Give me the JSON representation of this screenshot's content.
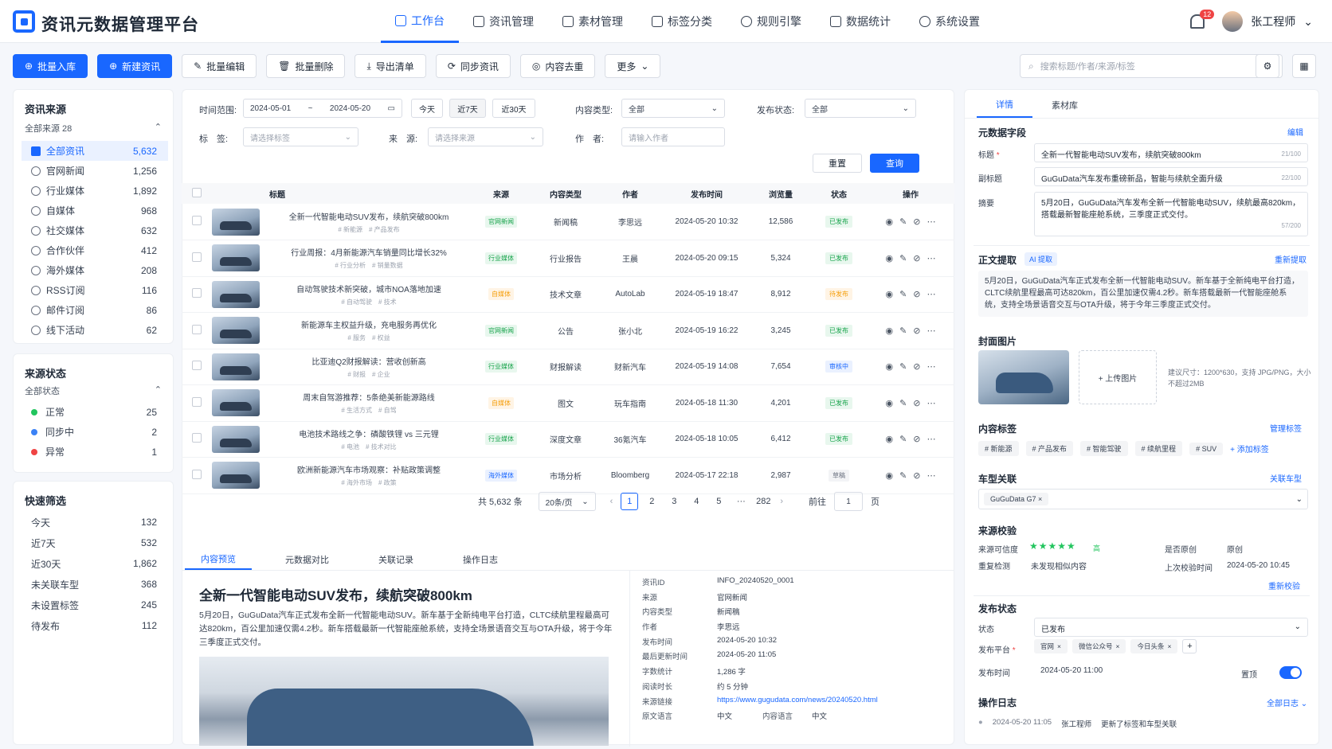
{
  "app": {
    "title": "资讯元数据管理平台"
  },
  "nav": [
    {
      "label": "工作台"
    },
    {
      "label": "资讯管理"
    },
    {
      "label": "素材管理"
    },
    {
      "label": "标签分类"
    },
    {
      "label": "规则引擎"
    },
    {
      "label": "数据统计"
    },
    {
      "label": "系统设置"
    }
  ],
  "user": {
    "name": "张工程师",
    "notifications": "12"
  },
  "toolbar": {
    "import": "批量入库",
    "new": "新建资讯",
    "edit": "批量编辑",
    "delete": "批量删除",
    "export": "导出清单",
    "sync": "同步资讯",
    "dedupe": "内容去重",
    "more": "更多",
    "search_placeholder": "搜索标题/作者/来源/标签"
  },
  "sources": {
    "title": "资讯来源",
    "all": "全部来源 28",
    "items": [
      {
        "label": "全部资讯",
        "count": "5,632"
      },
      {
        "label": "官网新闻",
        "count": "1,256"
      },
      {
        "label": "行业媒体",
        "count": "1,892"
      },
      {
        "label": "自媒体",
        "count": "968"
      },
      {
        "label": "社交媒体",
        "count": "632"
      },
      {
        "label": "合作伙伴",
        "count": "412"
      },
      {
        "label": "海外媒体",
        "count": "208"
      },
      {
        "label": "RSS订阅",
        "count": "116"
      },
      {
        "label": "邮件订阅",
        "count": "86"
      },
      {
        "label": "线下活动",
        "count": "62"
      }
    ]
  },
  "source_status": {
    "title": "来源状态",
    "all": "全部状态",
    "items": [
      {
        "label": "正常",
        "count": "25",
        "color": "#22c55e"
      },
      {
        "label": "同步中",
        "count": "2",
        "color": "#3b82f6"
      },
      {
        "label": "异常",
        "count": "1",
        "color": "#ef4444"
      }
    ]
  },
  "quick": {
    "title": "快速筛选",
    "items": [
      {
        "label": "今天",
        "count": "132"
      },
      {
        "label": "近7天",
        "count": "532"
      },
      {
        "label": "近30天",
        "count": "1,862"
      },
      {
        "label": "未关联车型",
        "count": "368"
      },
      {
        "label": "未设置标签",
        "count": "245"
      },
      {
        "label": "待发布",
        "count": "112"
      }
    ]
  },
  "filters": {
    "range_label": "时间范围:",
    "start": "2024-05-01",
    "tilde": "~",
    "end": "2024-05-20",
    "today": "今天",
    "d7": "近7天",
    "d30": "近30天",
    "type_label": "内容类型:",
    "type_val": "全部",
    "status_label": "发布状态:",
    "status_val": "全部",
    "tag_label": "标　签:",
    "tag_ph": "请选择标签",
    "src_label": "来　源:",
    "src_ph": "请选择来源",
    "author_label": "作　者:",
    "author_ph": "请输入作者",
    "reset": "重置",
    "query": "查询"
  },
  "table": {
    "headers": [
      "标题",
      "来源",
      "内容类型",
      "作者",
      "发布时间",
      "浏览量",
      "状态",
      "操作"
    ],
    "rows": [
      {
        "title": "全新一代智能电动SUV发布，续航突破800km",
        "tags": "# 新能源　# 产品发布",
        "source": "官网新闻",
        "type": "新闻稿",
        "author": "李思远",
        "time": "2024-05-20 10:32",
        "views": "12,586",
        "status": "已发布"
      },
      {
        "title": "行业周报：4月新能源汽车销量同比增长32%",
        "tags": "# 行业分析　# 销量数据",
        "source": "行业媒体",
        "type": "行业报告",
        "author": "王晨",
        "time": "2024-05-20 09:15",
        "views": "5,324",
        "status": "已发布"
      },
      {
        "title": "自动驾驶技术新突破，城市NOA落地加速",
        "tags": "# 自动驾驶　# 技术",
        "source": "自媒体",
        "type": "技术文章",
        "author": "AutoLab",
        "time": "2024-05-19 18:47",
        "views": "8,912",
        "status": "待发布"
      },
      {
        "title": "新能源车主权益升级，充电服务再优化",
        "tags": "# 服务　# 权益",
        "source": "官网新闻",
        "type": "公告",
        "author": "张小北",
        "time": "2024-05-19 16:22",
        "views": "3,245",
        "status": "已发布"
      },
      {
        "title": "比亚迪Q2财报解读：营收创新高",
        "tags": "# 财报　# 企业",
        "source": "行业媒体",
        "type": "财报解读",
        "author": "财新汽车",
        "time": "2024-05-19 14:08",
        "views": "7,654",
        "status": "审核中"
      },
      {
        "title": "周末自驾游推荐：5条绝美新能源路线",
        "tags": "# 生活方式　# 自驾",
        "source": "自媒体",
        "type": "图文",
        "author": "玩车指南",
        "time": "2024-05-18 11:30",
        "views": "4,201",
        "status": "已发布"
      },
      {
        "title": "电池技术路线之争：磷酸铁锂 vs 三元锂",
        "tags": "# 电池　# 技术对比",
        "source": "行业媒体",
        "type": "深度文章",
        "author": "36氪汽车",
        "time": "2024-05-18 10:05",
        "views": "6,412",
        "status": "已发布"
      },
      {
        "title": "欧洲新能源汽车市场观察：补贴政策调整",
        "tags": "# 海外市场　# 政策",
        "source": "海外媒体",
        "type": "市场分析",
        "author": "Bloomberg",
        "time": "2024-05-17 22:18",
        "views": "2,987",
        "status": "草稿"
      }
    ]
  },
  "pager": {
    "total": "共 5,632 条",
    "size": "20条/页",
    "pages": [
      "1",
      "2",
      "3",
      "4",
      "5",
      "···",
      "282"
    ],
    "goto": "前往",
    "goto_val": "1",
    "page_unit": "页"
  },
  "preview": {
    "tabs": [
      "内容预览",
      "元数据对比",
      "关联记录",
      "操作日志"
    ],
    "title": "全新一代智能电动SUV发布，续航突破800km",
    "body": "5月20日，GuGuData汽车正式发布全新一代智能电动SUV。新车基于全新纯电平台打造，CLTC续航里程最高可达820km，百公里加速仅需4.2秒。新车搭载最新一代智能座舱系统，支持全场景语音交互与OTA升级，将于今年三季度正式交付。",
    "meta": [
      {
        "k": "资讯ID",
        "v": "INFO_20240520_0001"
      },
      {
        "k": "来源",
        "v": "官网新闻"
      },
      {
        "k": "内容类型",
        "v": "新闻稿"
      },
      {
        "k": "作者",
        "v": "李思远"
      },
      {
        "k": "发布时间",
        "v": "2024-05-20 10:32"
      },
      {
        "k": "最后更新时间",
        "v": "2024-05-20 11:05"
      },
      {
        "k": "字数统计",
        "v": "1,286 字"
      },
      {
        "k": "阅读时长",
        "v": "约 5 分钟"
      },
      {
        "k": "来源链接",
        "v": "https://www.gugudata.com/news/20240520.html"
      },
      {
        "k": "原文语言",
        "v": "中文"
      }
    ],
    "lang_k": "内容语言",
    "lang_v": "中文"
  },
  "detail": {
    "tabs": [
      "详情",
      "素材库"
    ],
    "meta_title": "元数据字段",
    "edit": "编辑",
    "title_label": "标题",
    "title_val": "全新一代智能电动SUV发布，续航突破800km",
    "title_cnt": "21/100",
    "sub_label": "副标题",
    "sub_val": "GuGuData汽车发布重磅新品，智能与续航全面升级",
    "sub_cnt": "22/100",
    "sum_label": "摘要",
    "sum_val": "5月20日，GuGuData汽车发布全新一代智能电动SUV，续航最高820km，搭载最新智能座舱系统，三季度正式交付。",
    "sum_cnt": "57/200",
    "extract_title": "正文提取",
    "ai": "AI 提取",
    "re_extract": "重新提取",
    "extract_text": "5月20日，GuGuData汽车正式发布全新一代智能电动SUV。新车基于全新纯电平台打造，CLTC续航里程最高可达820km，百公里加速仅需4.2秒。新车搭载最新一代智能座舱系统，支持全场景语音交互与OTA升级，将于今年三季度正式交付。",
    "cover_title": "封面图片",
    "upload": "+ 上传图片",
    "cover_hint": "建议尺寸：1200*630，支持 JPG/PNG，大小不超过2MB",
    "tags_title": "内容标签",
    "manage_tags": "管理标签",
    "tags": [
      "# 新能源",
      "# 产品发布",
      "# 智能驾驶",
      "# 续航里程",
      "# SUV"
    ],
    "add_tag": "+ 添加标签",
    "model_title": "车型关联",
    "model_link": "关联车型",
    "model_val": "GuGuData G7",
    "check_title": "来源校验",
    "cred_label": "来源可信度",
    "cred_level": "高",
    "orig_label": "是否原创",
    "orig_val": "原创",
    "dup_label": "重复检测",
    "dup_val": "未发现相似内容",
    "last_label": "上次校验时间",
    "last_val": "2024-05-20 10:45",
    "recheck": "重新校验",
    "pub_title": "发布状态",
    "state_label": "状态",
    "state_val": "已发布",
    "platform_label": "发布平台",
    "platforms": [
      "官网",
      "微信公众号",
      "今日头条"
    ],
    "time_label": "发布时间",
    "time_val": "2024-05-20 11:00",
    "top_label": "置顶",
    "log_title": "操作日志",
    "all_logs": "全部日志",
    "log_time": "2024-05-20 11:05",
    "log_user": "张工程师",
    "log_text": "更新了标签和车型关联"
  }
}
